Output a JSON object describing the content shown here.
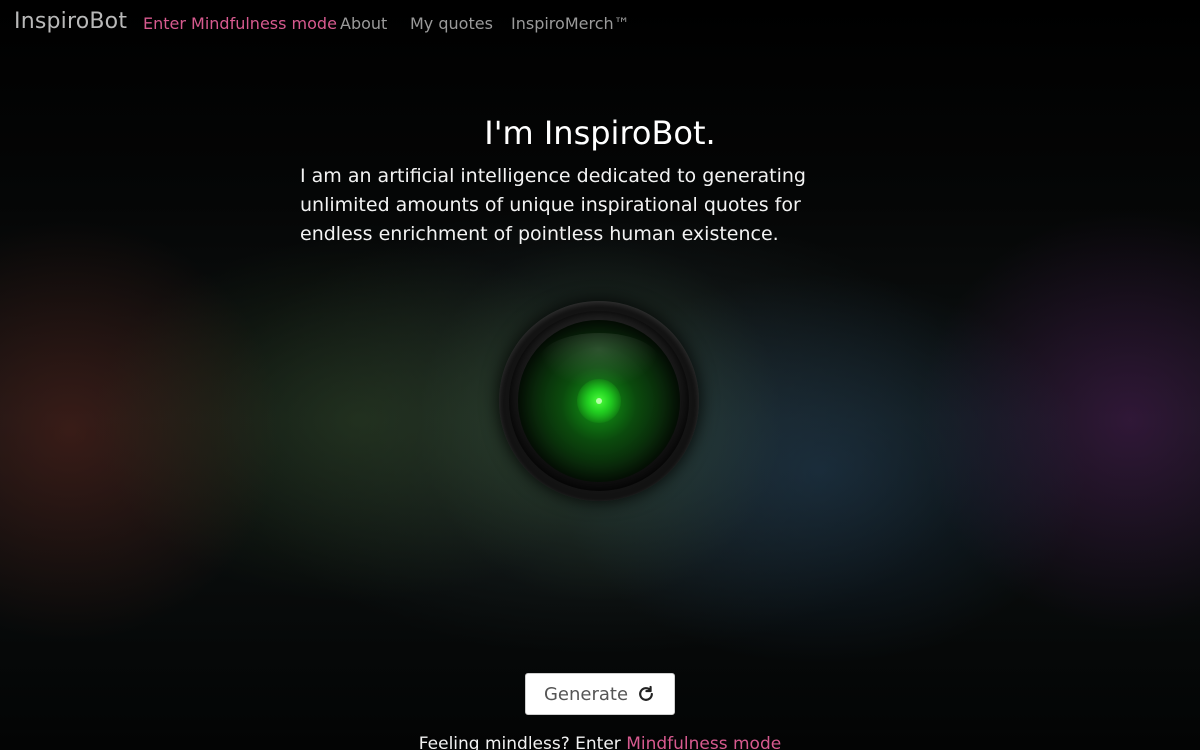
{
  "nav": {
    "brand": "InspiroBot",
    "links": [
      {
        "label": "Enter Mindfulness mode"
      },
      {
        "label": "About"
      },
      {
        "label": "My quotes"
      },
      {
        "label": "InspiroMerch™"
      }
    ]
  },
  "hero": {
    "title": "I'm InspiroBot.",
    "description": "I am an artificial intelligence dedicated to generating unlimited amounts of unique inspirational quotes for endless enrichment of pointless human existence."
  },
  "generate": {
    "label": "Generate",
    "icon": "refresh-icon"
  },
  "footer": {
    "prefix": "Feeling mindless? Enter ",
    "link": "Mindfulness mode"
  },
  "colors": {
    "accent_pink": "#d75a8f",
    "eye_green": "#22d021",
    "nav_gray": "#9a9a9a"
  }
}
